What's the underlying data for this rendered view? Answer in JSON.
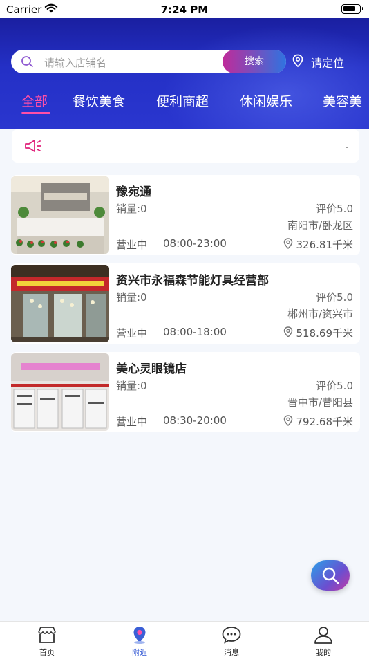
{
  "status_bar": {
    "carrier": "Carrier",
    "time": "7:24 PM"
  },
  "search": {
    "placeholder": "请输入店铺名",
    "button_label": "搜索"
  },
  "location": {
    "label": "请定位"
  },
  "categories": [
    "全部",
    "餐饮美食",
    "便利商超",
    "休闲娱乐",
    "美容美"
  ],
  "active_category": "全部",
  "colors": {
    "accent_pink": "#ff4fa8",
    "header_blue": "#2430c6",
    "tab_active": "#3b5fd6"
  },
  "shops": [
    {
      "name": "豫宛通",
      "sales": "销量:0",
      "rating": "评价5.0",
      "region": "南阳市/卧龙区",
      "status": "营业中",
      "hours": "08:00-23:00",
      "distance": "326.81千米"
    },
    {
      "name": "资兴市永福森节能灯具经营部",
      "sales": "销量:0",
      "rating": "评价5.0",
      "region": "郴州市/资兴市",
      "status": "营业中",
      "hours": "08:00-18:00",
      "distance": "518.69千米"
    },
    {
      "name": "美心灵眼镜店",
      "sales": "销量:0",
      "rating": "评价5.0",
      "region": "晋中市/昔阳县",
      "status": "营业中",
      "hours": "08:30-20:00",
      "distance": "792.68千米"
    }
  ],
  "tabbar": [
    {
      "label": "首页",
      "icon": "store-icon"
    },
    {
      "label": "附近",
      "icon": "nearby-pin-icon"
    },
    {
      "label": "消息",
      "icon": "message-icon"
    },
    {
      "label": "我的",
      "icon": "user-icon"
    }
  ],
  "active_tab": "附近"
}
